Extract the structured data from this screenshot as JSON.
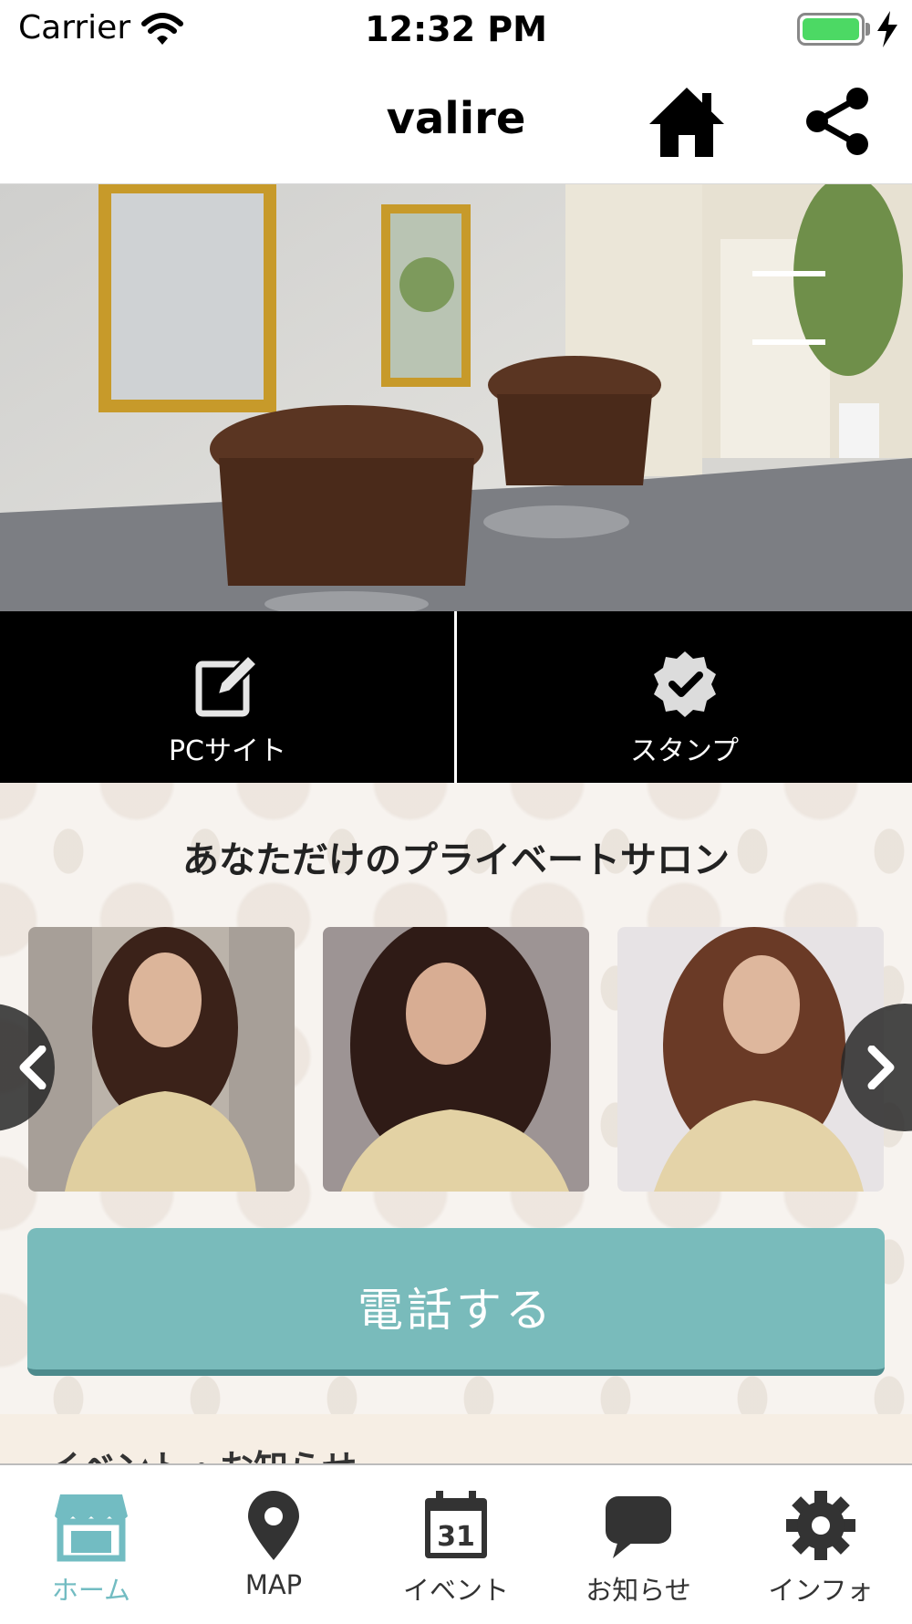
{
  "status_bar": {
    "carrier": "Carrier",
    "time": "12:32 PM",
    "battery_level": 1.0
  },
  "nav": {
    "title": "valire",
    "home_icon": "home-icon",
    "share_icon": "share-icon"
  },
  "hero": {
    "description": "hair-salon-interior-photo"
  },
  "quick_actions": [
    {
      "label": "PCサイト",
      "icon": "edit-icon"
    },
    {
      "label": "スタンプ",
      "icon": "stamp-check-icon"
    }
  ],
  "gallery": {
    "title": "あなただけのプライベートサロン",
    "items": [
      "style-photo-1",
      "style-photo-2",
      "style-photo-3"
    ]
  },
  "call_button": {
    "label": "電話する"
  },
  "next_section": {
    "title": "イベント・お知らせ"
  },
  "tabs": [
    {
      "label": "ホーム",
      "icon": "shop-icon",
      "active": true
    },
    {
      "label": "MAP",
      "icon": "map-pin-icon",
      "active": false
    },
    {
      "label": "イベント",
      "icon": "calendar-icon",
      "calendar_day": "31",
      "active": false
    },
    {
      "label": "お知らせ",
      "icon": "chat-bubble-icon",
      "active": false
    },
    {
      "label": "インフォ",
      "icon": "gear-icon",
      "active": false
    }
  ],
  "colors": {
    "accent": "#72bcc2",
    "call_button": "#79bbbb",
    "battery": "#4cd964"
  }
}
